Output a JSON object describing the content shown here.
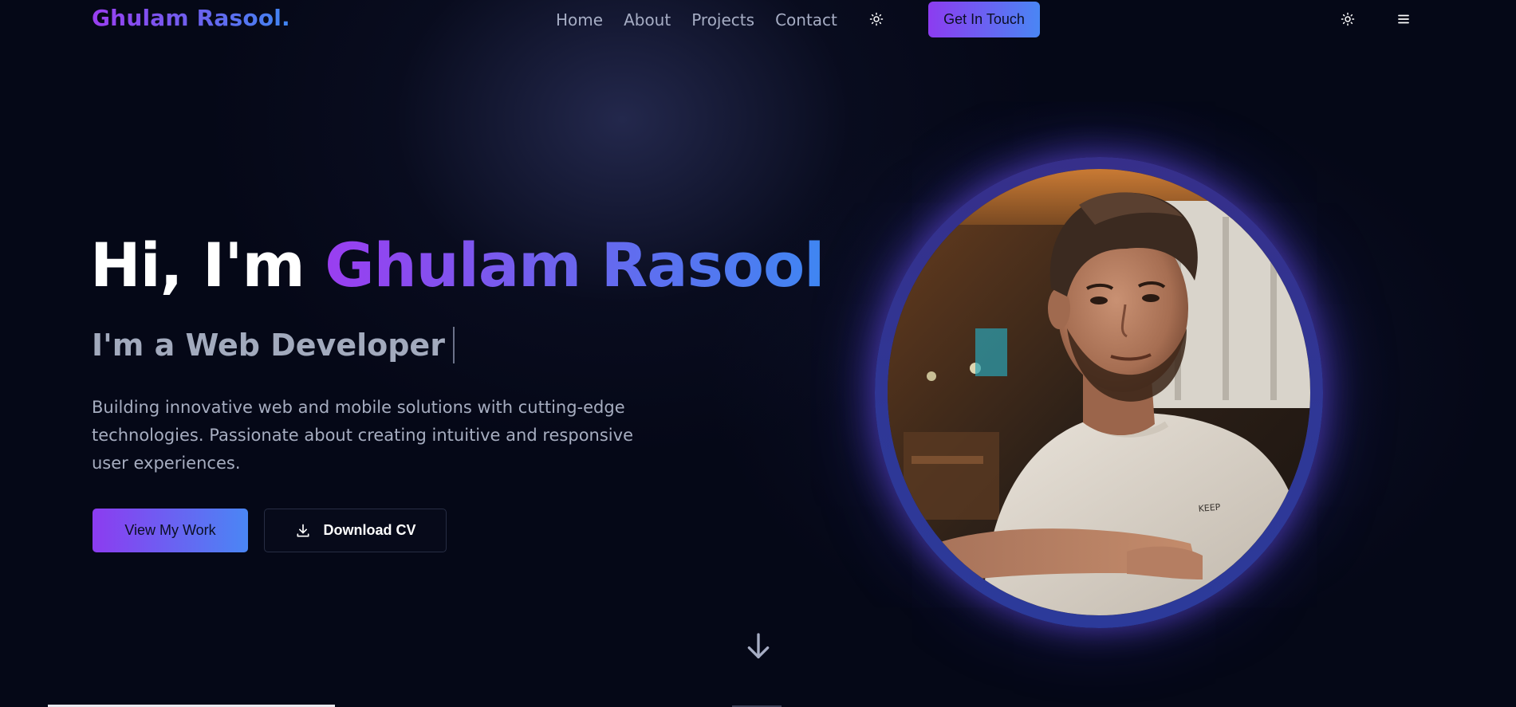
{
  "nav": {
    "logo": "Ghulam Rasool.",
    "links": [
      "Home",
      "About",
      "Projects",
      "Contact"
    ],
    "cta_label": "Get In Touch",
    "icons": [
      "sun-icon",
      "sun-icon",
      "menu-icon"
    ]
  },
  "hero": {
    "greeting": "Hi, I'm ",
    "name": "Ghulam Rasool",
    "subtitle": "I'm a Web Developer",
    "description": "Building innovative web and mobile solutions with cutting-edge technologies. Passionate about creating intuitive and responsive user experiences.",
    "primary_button": "View My Work",
    "secondary_button": "Download CV"
  },
  "portrait": {
    "shirt_text": "KEEP"
  },
  "colors": {
    "background": "#050817",
    "accent_start": "#9a3ef0",
    "accent_end": "#3f86f2",
    "text_muted": "#a6adc0"
  },
  "scroll_indicator_icon": "arrow-down-icon"
}
